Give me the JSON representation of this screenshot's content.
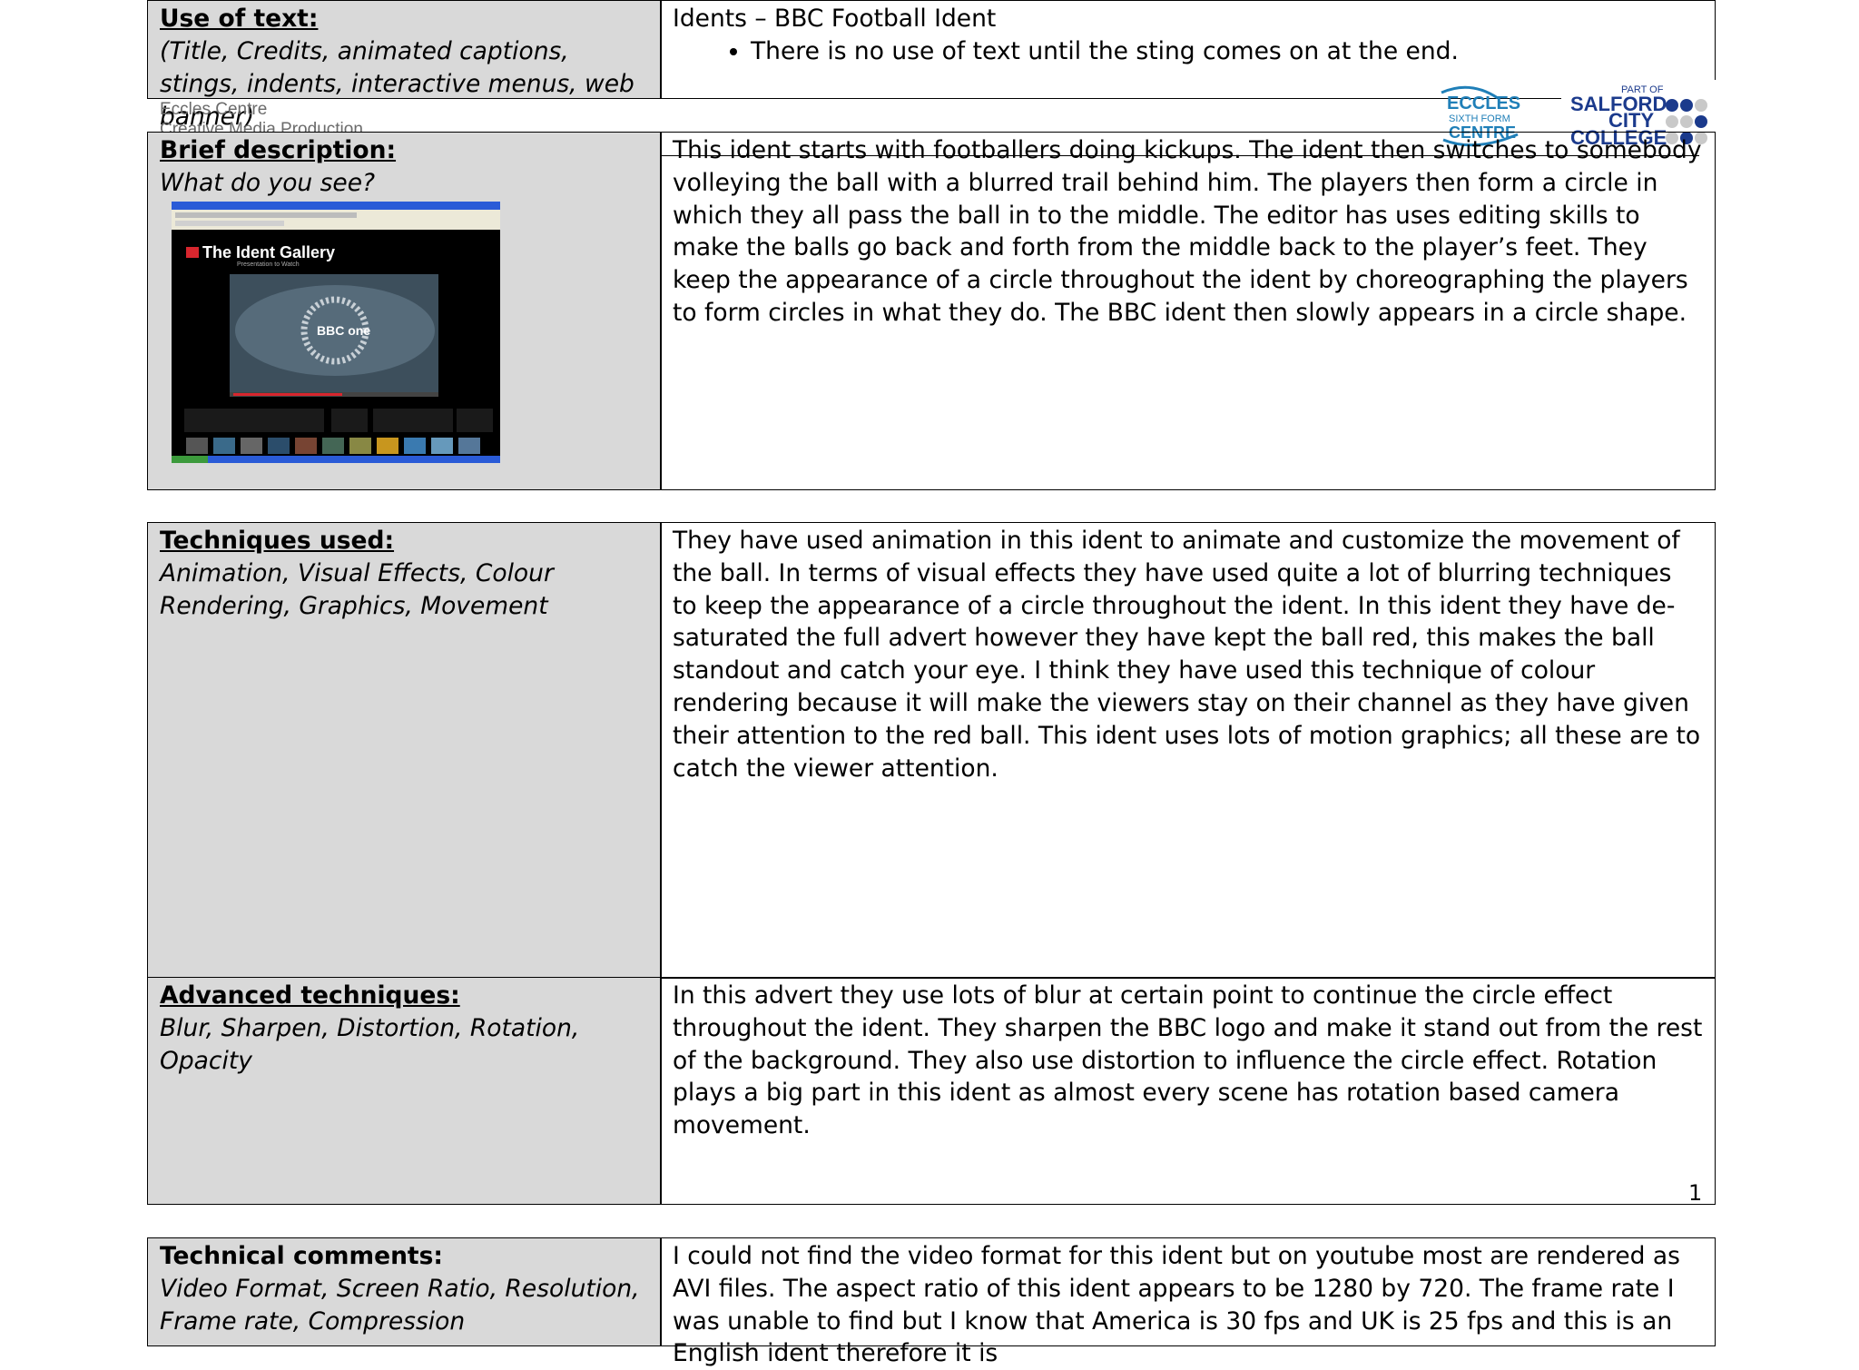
{
  "sections": {
    "use_of_text": {
      "heading": "Use of text:",
      "hint": "(Title, Credits, animated captions, stings, indents, interactive menus, web banner)",
      "title": "Idents – BBC Football Ident",
      "bullet": "There is no use of text until the sting comes on at the end."
    },
    "brief_description": {
      "heading": "Brief description:",
      "hint": "What do you see?",
      "body": "This ident starts with footballers doing kickups. The ident then switches to somebody volleying the ball with a blurred trail behind him. The players then form a circle in which they all pass the ball in to the middle. The editor has uses editing skills to make the balls go back and forth from the middle back to the player’s feet. They keep the appearance of a circle throughout the ident by choreographing the players to form circles in what they do. The BBC ident then slowly appears in a circle shape."
    },
    "techniques_used": {
      "heading": "Techniques used:",
      "hint": "Animation, Visual Effects, Colour Rendering, Graphics, Movement",
      "body": "They have used animation in this ident to animate and customize the movement of the ball. In terms of visual effects they have used quite a lot of blurring techniques to keep the appearance of a circle throughout the ident. In this ident they have de-saturated the full advert however they have kept the ball red, this makes the ball standout and catch your eye. I think they have used this technique of colour rendering because it will make the viewers stay on their channel as they have given their attention to the red ball. This ident uses lots of motion graphics; all these are to catch the viewer attention."
    },
    "advanced_techniques": {
      "heading": "Advanced techniques:",
      "hint": "Blur, Sharpen, Distortion, Rotation, Opacity",
      "body": "In this advert they use lots of blur at certain point to continue the circle effect throughout the ident. They sharpen the BBC logo and make it stand out from the rest of the background. They also use distortion to influence the circle effect. Rotation plays a big part in this ident as almost every scene has rotation based camera movement."
    },
    "technical_comments": {
      "heading": "Technical comments:",
      "hint": "Video Format, Screen Ratio, Resolution, Frame rate, Compression",
      "body": "I could not find the video format for this ident but on youtube most are rendered as AVI files. The aspect ratio of this ident appears to be 1280 by 720. The frame rate I was unable to find but I know that America is 30 fps and UK is 25 fps and this is an English ident therefore it is"
    }
  },
  "header": {
    "centre_line1": "Eccles Centre",
    "centre_line2": "Creative Media Production",
    "eccles_logo_text": "ECCLES SIXTH FORM CENTRE",
    "salford_logo_text": "PART OF SALFORD CITY COLLEGE"
  },
  "screenshot": {
    "gallery_title": "The Ident Gallery",
    "gallery_subtitle": "Presentation to Watch",
    "logo_text": "BBC one"
  },
  "footer": {
    "page_number": "1"
  },
  "colors": {
    "label_bg": "#d9d9d9",
    "eccles_blue": "#1f7fb8",
    "salford_navy": "#1b3a8c"
  }
}
